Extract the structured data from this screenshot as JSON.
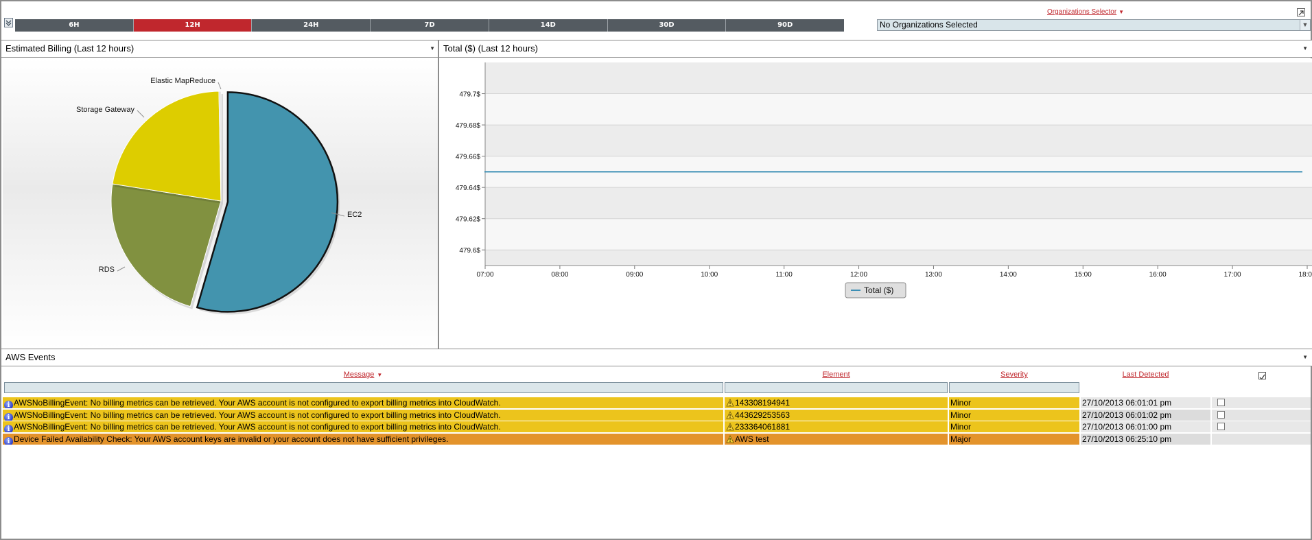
{
  "time_ranges": [
    {
      "label": "6H",
      "active": false
    },
    {
      "label": "12H",
      "active": true
    },
    {
      "label": "24H",
      "active": false
    },
    {
      "label": "7D",
      "active": false
    },
    {
      "label": "14D",
      "active": false
    },
    {
      "label": "30D",
      "active": false
    },
    {
      "label": "90D",
      "active": false
    }
  ],
  "org_selector": {
    "label": "Organizations Selector",
    "value": "No Organizations Selected"
  },
  "billing_panel": {
    "title": "Estimated Billing (Last 12 hours)"
  },
  "total_panel": {
    "title": "Total ($) (Last 12 hours)"
  },
  "events_panel": {
    "title": "AWS Events",
    "columns": {
      "message": "Message",
      "element": "Element",
      "severity": "Severity",
      "last_detected": "Last Detected"
    },
    "rows": [
      {
        "message": "AWSNoBillingEvent: No billing metrics can be retrieved. Your AWS account is not configured to export billing metrics into CloudWatch.",
        "element": "143308194941",
        "severity": "Minor",
        "last_detected": "27/10/2013 06:01:01 pm",
        "has_checkbox": true
      },
      {
        "message": "AWSNoBillingEvent: No billing metrics can be retrieved. Your AWS account is not configured to export billing metrics into CloudWatch.",
        "element": "443629253563",
        "severity": "Minor",
        "last_detected": "27/10/2013 06:01:02 pm",
        "has_checkbox": true
      },
      {
        "message": "AWSNoBillingEvent: No billing metrics can be retrieved. Your AWS account is not configured to export billing metrics into CloudWatch.",
        "element": "233364061881",
        "severity": "Minor",
        "last_detected": "27/10/2013 06:01:00 pm",
        "has_checkbox": true
      },
      {
        "message": "Device Failed Availability Check: Your AWS account keys are invalid or your account does not have sufficient privileges.",
        "element": "AWS test",
        "severity": "Major",
        "last_detected": "27/10/2013 06:25:10 pm",
        "has_checkbox": false
      }
    ]
  },
  "colors": {
    "active_range": "#c0272d",
    "minor": "#ecc41c",
    "major": "#e3932b",
    "ec2": "#4394ae",
    "rds": "#819140",
    "storage_gateway": "#ddcd00",
    "elastic_mapreduce": "#d8d8d8",
    "line": "#3c8fb5"
  },
  "chart_data": [
    {
      "type": "pie",
      "title": "",
      "slices": [
        {
          "label": "EC2",
          "value": 54.5,
          "color": "#4394ae",
          "exploded": true
        },
        {
          "label": "RDS",
          "value": 23.0,
          "color": "#819140",
          "exploded": false
        },
        {
          "label": "Storage Gateway",
          "value": 22.2,
          "color": "#ddcd00",
          "exploded": false
        },
        {
          "label": "Elastic MapReduce",
          "value": 0.3,
          "color": "#d8d8d8",
          "exploded": false
        }
      ]
    },
    {
      "type": "line",
      "x": [
        "07:00",
        "08:00",
        "09:00",
        "10:00",
        "11:00",
        "12:00",
        "13:00",
        "14:00",
        "15:00",
        "16:00",
        "17:00",
        "18:00"
      ],
      "series": [
        {
          "name": "Total ($)",
          "values": [
            479.65,
            479.65,
            479.65,
            479.65,
            479.65,
            479.65,
            479.65,
            479.65,
            479.65,
            479.65,
            479.65,
            479.65
          ]
        }
      ],
      "yticks": [
        "479.6$",
        "479.62$",
        "479.64$",
        "479.66$",
        "479.68$",
        "479.7$"
      ],
      "ylim": [
        479.59,
        479.72
      ],
      "legend": "bottom-center",
      "grid": true
    }
  ]
}
